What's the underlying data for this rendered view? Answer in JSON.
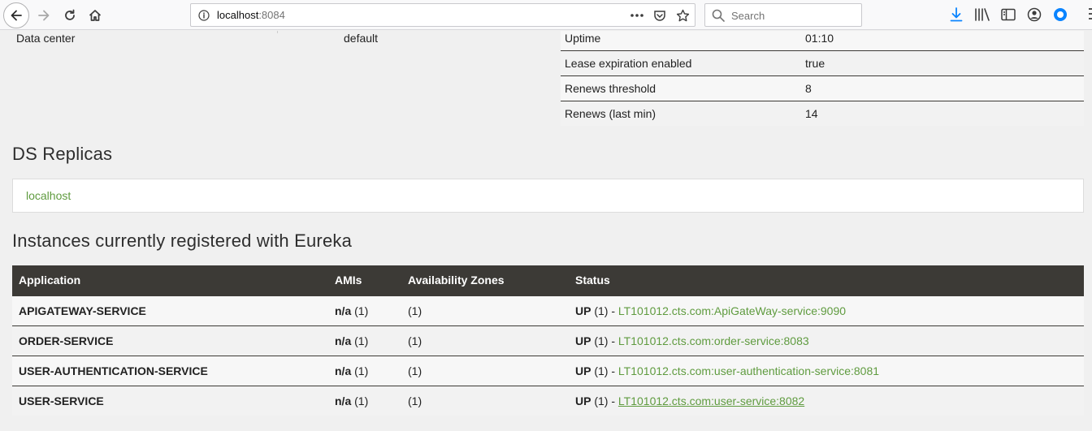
{
  "browser": {
    "url_host": "localhost",
    "url_port": ":8084",
    "search_placeholder": "Search",
    "colors": {
      "accent": "#0a84ff",
      "icon": "#3c3c3c"
    }
  },
  "left_info": {
    "label": "Data center",
    "value": "default"
  },
  "stats": [
    {
      "key": "Uptime",
      "value": "01:10"
    },
    {
      "key": "Lease expiration enabled",
      "value": "true"
    },
    {
      "key": "Renews threshold",
      "value": "8"
    },
    {
      "key": "Renews (last min)",
      "value": "14"
    }
  ],
  "ds_replicas": {
    "title": "DS Replicas",
    "items": [
      "localhost"
    ]
  },
  "instances": {
    "title": "Instances currently registered with Eureka",
    "headers": [
      "Application",
      "AMIs",
      "Availability Zones",
      "Status"
    ],
    "rows": [
      {
        "app": "APIGATEWAY-SERVICE",
        "ami_bold": "n/a",
        "ami_count": " (1)",
        "zones": "(1)",
        "status": "UP",
        "status_count": " (1) - ",
        "instance": "LT101012.cts.com:ApiGateWay-service:9090"
      },
      {
        "app": "ORDER-SERVICE",
        "ami_bold": "n/a",
        "ami_count": " (1)",
        "zones": "(1)",
        "status": "UP",
        "status_count": " (1) - ",
        "instance": "LT101012.cts.com:order-service:8083"
      },
      {
        "app": "USER-AUTHENTICATION-SERVICE",
        "ami_bold": "n/a",
        "ami_count": " (1)",
        "zones": "(1)",
        "status": "UP",
        "status_count": " (1) - ",
        "instance": "LT101012.cts.com:user-authentication-service:8081"
      },
      {
        "app": "USER-SERVICE",
        "ami_bold": "n/a",
        "ami_count": " (1)",
        "zones": "(1)",
        "status": "UP",
        "status_count": " (1) - ",
        "instance": "LT101012.cts.com:user-service:8082"
      }
    ],
    "colors": {
      "header_bg": "#3c3a36",
      "link": "#5f9b3f"
    }
  }
}
